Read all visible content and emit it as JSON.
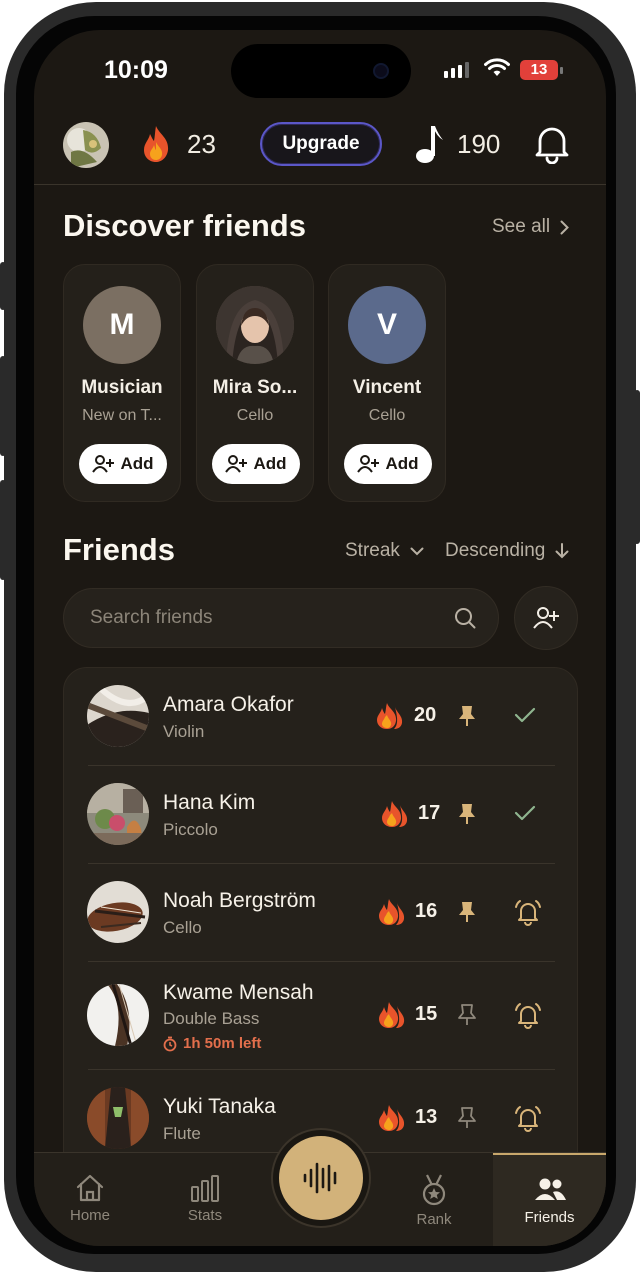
{
  "status_bar": {
    "time": "10:09",
    "battery": "13"
  },
  "header": {
    "streak_count": "23",
    "upgrade_label": "Upgrade",
    "notes_count": "190"
  },
  "discover": {
    "title": "Discover friends",
    "see_all": "See all",
    "cards": [
      {
        "initial": "M",
        "name": "Musician",
        "subtitle": "New on T...",
        "add_label": "Add",
        "avatar_color": "#7b6f62"
      },
      {
        "initial": "",
        "name": "Mira So...",
        "subtitle": "Cello",
        "add_label": "Add",
        "avatar_color": "#5a4d45"
      },
      {
        "initial": "V",
        "name": "Vincent",
        "subtitle": "Cello",
        "add_label": "Add",
        "avatar_color": "#5b6a8c"
      }
    ]
  },
  "friends": {
    "title": "Friends",
    "sort_label": "Streak",
    "order_label": "Descending",
    "search_placeholder": "Search friends",
    "list": [
      {
        "name": "Amara Okafor",
        "instrument": "Violin",
        "streak": "20",
        "pinned": true,
        "action": "check"
      },
      {
        "name": "Hana Kim",
        "instrument": "Piccolo",
        "streak": "17",
        "pinned": true,
        "action": "check"
      },
      {
        "name": "Noah Bergström",
        "instrument": "Cello",
        "streak": "16",
        "pinned": true,
        "action": "nudge"
      },
      {
        "name": "Kwame Mensah",
        "instrument": "Double Bass",
        "timer": "1h 50m left",
        "streak": "15",
        "pinned": false,
        "action": "nudge"
      },
      {
        "name": "Yuki Tanaka",
        "instrument": "Flute",
        "streak": "13",
        "pinned": false,
        "action": "nudge"
      }
    ]
  },
  "nav": {
    "home": "Home",
    "stats": "Stats",
    "rank": "Rank",
    "friends": "Friends"
  },
  "colors": {
    "accent_gold": "#d2b27a",
    "background": "#1c1813",
    "upgrade_border": "#5b57c8",
    "timer_red": "#e36f4c"
  }
}
